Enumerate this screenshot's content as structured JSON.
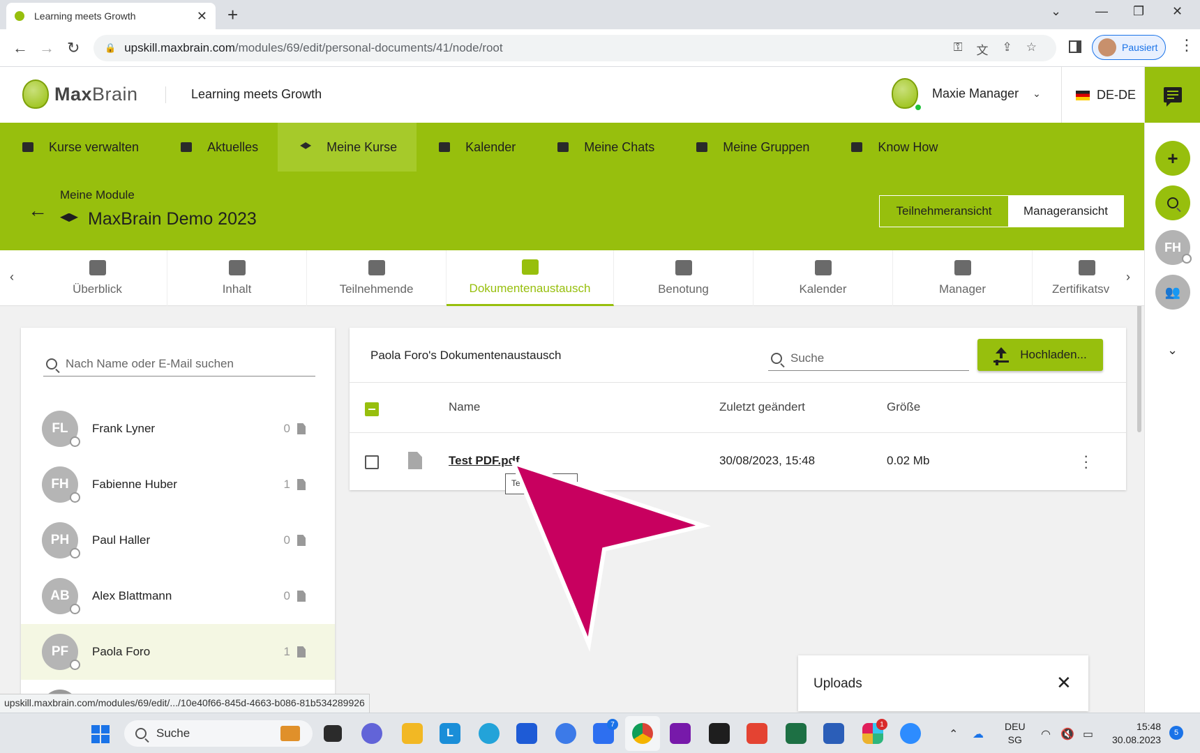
{
  "browser": {
    "tab_title": "Learning meets Growth",
    "url_host": "upskill.maxbrain.com",
    "url_path": "/modules/69/edit/personal-documents/41/node/root",
    "profile_label": "Pausiert",
    "status_url": "upskill.maxbrain.com/modules/69/edit/.../10e40f66-845d-4663-b086-81b534289926"
  },
  "header": {
    "logo_bold": "Max",
    "logo_light": "Brain",
    "tagline": "Learning meets Growth",
    "user_name": "Maxie Manager",
    "language": "DE-DE"
  },
  "rail": {
    "user_initials": "FH"
  },
  "nav": {
    "items": [
      {
        "label": "Kurse verwalten"
      },
      {
        "label": "Aktuelles"
      },
      {
        "label": "Meine Kurse"
      },
      {
        "label": "Kalender"
      },
      {
        "label": "Meine Chats"
      },
      {
        "label": "Meine Gruppen"
      },
      {
        "label": "Know How"
      }
    ]
  },
  "module": {
    "parent": "Meine Module",
    "title": "MaxBrain Demo 2023",
    "view_participant": "Teilnehmeransicht",
    "view_manager": "Manageransicht"
  },
  "tabs": [
    {
      "label": "Überblick"
    },
    {
      "label": "Inhalt"
    },
    {
      "label": "Teilnehmende"
    },
    {
      "label": "Dokumentenaustausch"
    },
    {
      "label": "Benotung"
    },
    {
      "label": "Kalender"
    },
    {
      "label": "Manager"
    },
    {
      "label": "Zertifikatsv"
    }
  ],
  "people_panel": {
    "search_placeholder": "Nach Name oder E-Mail suchen",
    "people": [
      {
        "initials": "FL",
        "name": "Frank Lyner",
        "count": "0"
      },
      {
        "initials": "FH",
        "name": "Fabienne Huber",
        "count": "1"
      },
      {
        "initials": "PH",
        "name": "Paul Haller",
        "count": "0"
      },
      {
        "initials": "AB",
        "name": "Alex Blattmann",
        "count": "0"
      },
      {
        "initials": "PF",
        "name": "Paola Foro",
        "count": "1"
      }
    ]
  },
  "documents": {
    "title": "Paola Foro's Dokumentenaustausch",
    "search_placeholder": "Suche",
    "upload_label": "Hochladen...",
    "columns": {
      "name": "Name",
      "modified": "Zuletzt geändert",
      "size": "Größe"
    },
    "rows": [
      {
        "name": "Test PDF.pdf",
        "modified": "30/08/2023, 15:48",
        "size": "0.02 Mb"
      }
    ],
    "tooltip": "Te            .pdf"
  },
  "uploads": {
    "label": "Uploads"
  },
  "taskbar": {
    "search_label": "Suche",
    "lang_top": "DEU",
    "lang_bottom": "SG",
    "time": "15:48",
    "date": "30.08.2023",
    "notification_count": "5",
    "todo_badge": "7",
    "slack_badge": "1"
  },
  "colors": {
    "brand_green": "#97bf0d",
    "cursor_magenta": "#c8005f"
  }
}
